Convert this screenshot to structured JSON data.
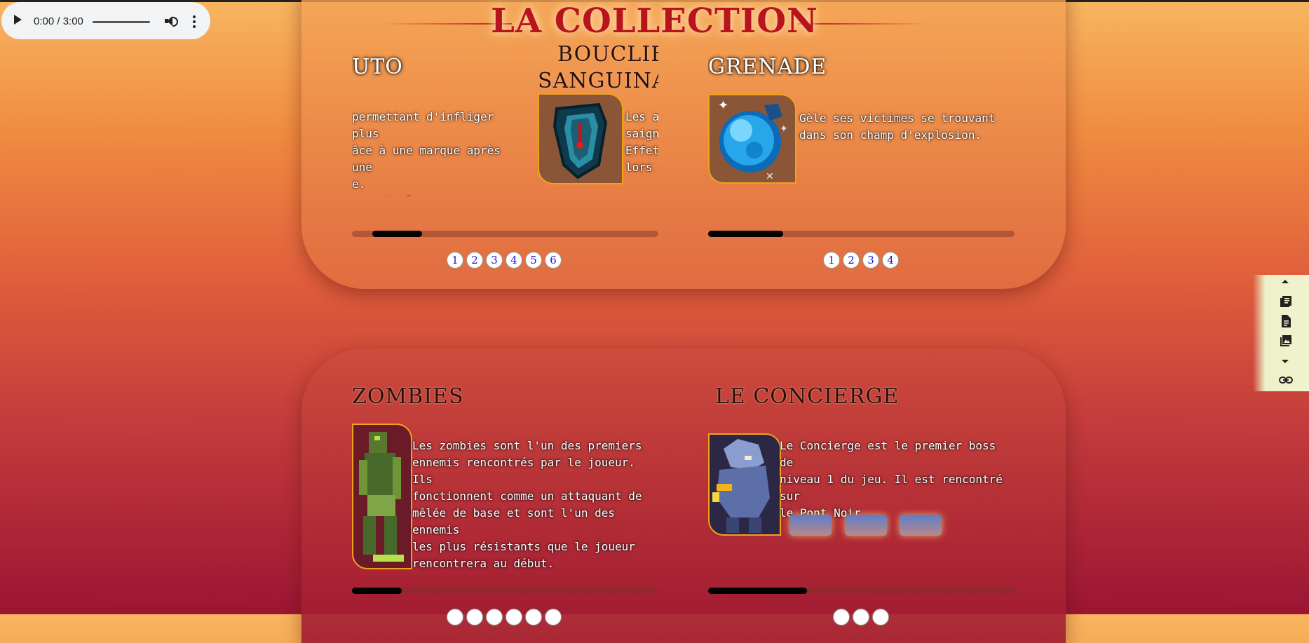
{
  "audio": {
    "time": "0:00 / 3:00"
  },
  "page_title": "LA COLLECTION",
  "section1": {
    "card_left": {
      "heading": "UTO",
      "desc": "permettant d'infliger plus\nâce à une marque après une\ne.\n meurt, la marque s'étend.",
      "progress": 0.16,
      "pages": [
        "1",
        "2",
        "3",
        "4",
        "5",
        "6"
      ]
    },
    "card_middle": {
      "heading_line1": "BOUCLIER",
      "heading_line2": "SANGUINAI",
      "desc": "Les at\nsaigne\nEffet\nlors c"
    },
    "card_right": {
      "heading": "GRENADE",
      "desc": "Gèle ses victimes se trouvant\ndans son champ d'explosion.",
      "progress": 0.24,
      "pages": [
        "1",
        "2",
        "3",
        "4"
      ]
    }
  },
  "section2": {
    "card_left": {
      "heading": "ZOMBIES",
      "desc": "Les zombies sont l'un des premiers\nennemis rencontrés par le joueur. Ils\nfonctionnent comme un attaquant de\nmêlée de base et sont l'un des ennemis\nles plus résistants que le joueur\nrencontrera au début.",
      "progress": 0.16
    },
    "card_right": {
      "heading": "LE CONCIERGE",
      "desc": "Le Concierge est le premier boss de\nniveau 1 du jeu. Il est rencontré sur\nle Pont Noir.",
      "progress": 0.32
    }
  },
  "toolbar": {
    "icons": [
      "collapse-up-icon",
      "book-icon",
      "document-icon",
      "image-icon",
      "expand-down-icon",
      "link-icon"
    ]
  }
}
